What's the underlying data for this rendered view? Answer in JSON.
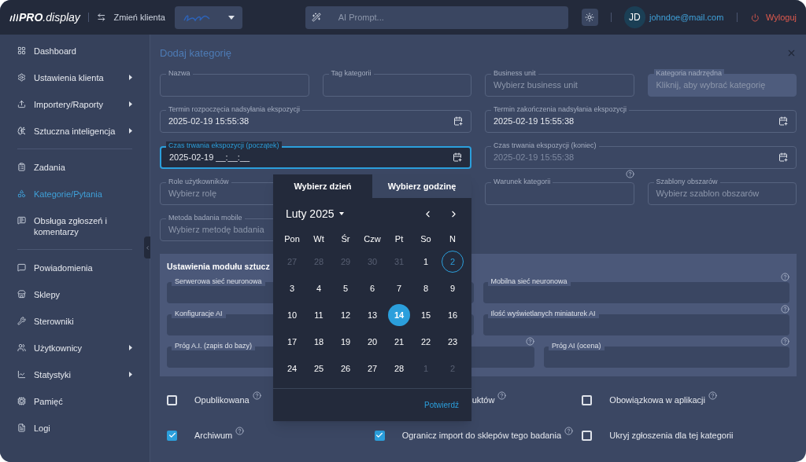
{
  "topbar": {
    "logo_bold": "PRO",
    "logo_light": ".display",
    "switch_label": "Zmień klienta",
    "ai_prompt": {
      "placeholder": "AI Prompt..."
    },
    "avatar": "JD",
    "email": "johndoe@mail.com",
    "logout": "Wyloguj"
  },
  "sidebar": {
    "groups": [
      [
        {
          "label": "Dashboard",
          "selected": false,
          "has_submenu": false
        },
        {
          "label": "Ustawienia klienta",
          "selected": false,
          "has_submenu": true
        },
        {
          "label": "Importery/Raporty",
          "selected": false,
          "has_submenu": true
        },
        {
          "label": "Sztuczna inteligencja",
          "selected": false,
          "has_submenu": true
        }
      ],
      [
        {
          "label": "Zadania",
          "selected": false,
          "has_submenu": false
        },
        {
          "label": "Kategorie/Pytania",
          "selected": true,
          "has_submenu": false
        },
        {
          "label": "Obsługa zgłoszeń i komentarzy",
          "selected": false,
          "has_submenu": false
        }
      ],
      [
        {
          "label": "Powiadomienia",
          "selected": false,
          "has_submenu": false
        },
        {
          "label": "Sklepy",
          "selected": false,
          "has_submenu": false
        },
        {
          "label": "Sterowniki",
          "selected": false,
          "has_submenu": false
        },
        {
          "label": "Użytkownicy",
          "selected": false,
          "has_submenu": true
        },
        {
          "label": "Statystyki",
          "selected": false,
          "has_submenu": true
        },
        {
          "label": "Pamięć",
          "selected": false,
          "has_submenu": false
        },
        {
          "label": "Logi",
          "selected": false,
          "has_submenu": false
        }
      ]
    ]
  },
  "dialog": {
    "title": "Dodaj kategorię",
    "field_groups": [
      [
        {
          "label": "Nazwa",
          "disabled": false
        },
        {
          "label": "Tag kategorii",
          "disabled": false
        },
        {
          "label": "Business unit",
          "placeholder": "Wybierz business unit",
          "disabled": false
        },
        {
          "label": "Kategoria nadrzędna",
          "placeholder": "Kliknij, aby wybrać kategorię",
          "disabled": true
        }
      ],
      [
        {
          "label": "Termin rozpoczęcia nadsyłania ekspozycji",
          "value": "2025-02-19 15:55:38",
          "kind": "date",
          "disabled": false,
          "focused": false
        },
        {
          "label": "Termin zakończenia nadsyłania ekspozycji",
          "value": "2025-02-19 15:55:38",
          "kind": "date",
          "disabled": false,
          "focused": false
        }
      ],
      [
        {
          "label": "Czas trwania ekspozycji (początek)",
          "value": "2025-02-19 __:__:__",
          "kind": "date",
          "disabled": false,
          "focused": true
        },
        {
          "label": "Czas trwania ekspozycji (koniec)",
          "value": "2025-02-19 15:55:38",
          "kind": "date",
          "disabled": true,
          "focused": false
        }
      ],
      [
        {
          "label": "Role użytkowników",
          "placeholder": "Wybierz rolę",
          "disabled": false,
          "wide": true
        },
        {
          "label": "Warunek kategorii",
          "disabled": false,
          "help": true
        },
        {
          "label": "Szablony obszarów",
          "placeholder": "Wybierz szablon obszarów",
          "disabled": false
        }
      ],
      [
        {
          "label": "Metoda badania mobile",
          "placeholder": "Wybierz metodę badania",
          "disabled": false
        }
      ]
    ],
    "ai_panel": {
      "title": "Ustawienia modułu sztucz",
      "field_groups": [
        [
          {
            "label": "Serwerowa sieć neuronowa"
          },
          {
            "label": "Mobilna sieć neuronowa",
            "help": true
          }
        ],
        [
          {
            "label": "Konfiguracje AI"
          },
          {
            "label": "Ilość wyświetlanych miniaturek AI",
            "help": true
          }
        ],
        [
          {
            "label": "Próg A.I. (zapis do bazy)"
          },
          {
            "help": true
          },
          {
            "label": "Próg AI (ocena)",
            "help": true
          }
        ]
      ]
    },
    "checkboxes": [
      [
        {
          "label": "Opublikowana",
          "checked": false,
          "help": true
        },
        {
          "label": "uktów",
          "help": true,
          "kind": "partial"
        },
        {
          "label": "Obowiązkowa w aplikacji",
          "checked": false,
          "help": true
        }
      ],
      [
        {
          "label": "Archiwum",
          "checked": true,
          "help": true
        },
        {
          "label": "Ogranicz import do sklepów tego badania",
          "checked": true,
          "help": true
        },
        {
          "label": "Ukryj zgłoszenia dla tej kategorii",
          "checked": false,
          "help": false
        }
      ]
    ]
  },
  "calendar": {
    "tabs": [
      {
        "label": "Wybierz dzień",
        "selected": true
      },
      {
        "label": "Wybierz godzinę",
        "selected": false
      }
    ],
    "month": "Luty 2025",
    "weekdays": [
      "Pon",
      "Wt",
      "Śr",
      "Czw",
      "Pt",
      "So",
      "N"
    ],
    "days": [
      {
        "label": "27",
        "outside": true,
        "selected": false,
        "today": false
      },
      {
        "label": "28",
        "outside": true,
        "selected": false,
        "today": false
      },
      {
        "label": "29",
        "outside": true,
        "selected": false,
        "today": false
      },
      {
        "label": "30",
        "outside": true,
        "selected": false,
        "today": false
      },
      {
        "label": "31",
        "outside": true,
        "selected": false,
        "today": false
      },
      {
        "label": "1",
        "outside": false,
        "selected": false,
        "today": false
      },
      {
        "label": "2",
        "outside": false,
        "selected": false,
        "today": true
      },
      {
        "label": "3",
        "outside": false,
        "selected": false,
        "today": false
      },
      {
        "label": "4",
        "outside": false,
        "selected": false,
        "today": false
      },
      {
        "label": "5",
        "outside": false,
        "selected": false,
        "today": false
      },
      {
        "label": "6",
        "outside": false,
        "selected": false,
        "today": false
      },
      {
        "label": "7",
        "outside": false,
        "selected": false,
        "today": false
      },
      {
        "label": "8",
        "outside": false,
        "selected": false,
        "today": false
      },
      {
        "label": "9",
        "outside": false,
        "selected": false,
        "today": false
      },
      {
        "label": "10",
        "outside": false,
        "selected": false,
        "today": false
      },
      {
        "label": "11",
        "outside": false,
        "selected": false,
        "today": false
      },
      {
        "label": "12",
        "outside": false,
        "selected": false,
        "today": false
      },
      {
        "label": "13",
        "outside": false,
        "selected": false,
        "today": false
      },
      {
        "label": "14",
        "outside": false,
        "selected": true,
        "today": false
      },
      {
        "label": "15",
        "outside": false,
        "selected": false,
        "today": false
      },
      {
        "label": "16",
        "outside": false,
        "selected": false,
        "today": false
      },
      {
        "label": "17",
        "outside": false,
        "selected": false,
        "today": false
      },
      {
        "label": "18",
        "outside": false,
        "selected": false,
        "today": false
      },
      {
        "label": "19",
        "outside": false,
        "selected": false,
        "today": false
      },
      {
        "label": "20",
        "outside": false,
        "selected": false,
        "today": false
      },
      {
        "label": "21",
        "outside": false,
        "selected": false,
        "today": false
      },
      {
        "label": "22",
        "outside": false,
        "selected": false,
        "today": false
      },
      {
        "label": "23",
        "outside": false,
        "selected": false,
        "today": false
      },
      {
        "label": "24",
        "outside": false,
        "selected": false,
        "today": false
      },
      {
        "label": "25",
        "outside": false,
        "selected": false,
        "today": false
      },
      {
        "label": "26",
        "outside": false,
        "selected": false,
        "today": false
      },
      {
        "label": "27",
        "outside": false,
        "selected": false,
        "today": false
      },
      {
        "label": "28",
        "outside": false,
        "selected": false,
        "today": false
      },
      {
        "label": "1",
        "outside": true,
        "selected": false,
        "today": false
      },
      {
        "label": "2",
        "outside": true,
        "selected": false,
        "today": false
      }
    ],
    "confirm": "Potwierdź"
  }
}
